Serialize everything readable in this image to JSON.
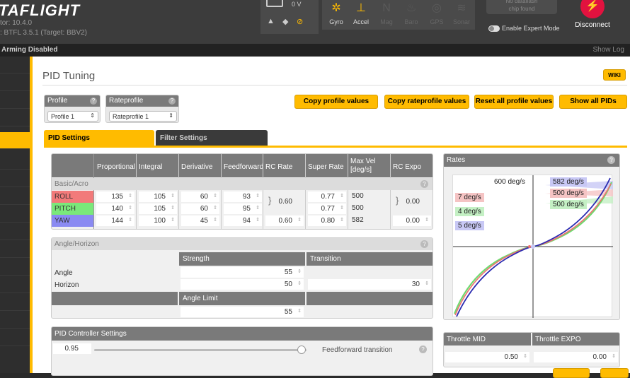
{
  "header": {
    "logo_text": "TAFLIGHT",
    "configurator_version": "tor: 10.4.0",
    "firmware_version": ": BTFL 3.5.1 (Target: BBV2)",
    "battery_voltage": "0 V",
    "sensors": [
      {
        "label": "Gyro",
        "icon": "gyro-icon",
        "active": true
      },
      {
        "label": "Accel",
        "icon": "accel-icon",
        "active": true
      },
      {
        "label": "Mag",
        "icon": "mag-icon",
        "active": false
      },
      {
        "label": "Baro",
        "icon": "baro-icon",
        "active": false
      },
      {
        "label": "GPS",
        "icon": "gps-icon",
        "active": false
      },
      {
        "label": "Sonar",
        "icon": "sonar-icon",
        "active": false
      }
    ],
    "dataflash": "No dataflash\nchip found",
    "expert_mode_label": "Enable Expert Mode",
    "disconnect_label": "Disconnect"
  },
  "status": {
    "arming": "Arming Disabled",
    "show_log": "Show Log"
  },
  "page": {
    "title": "PID Tuning",
    "wiki": "WIKI"
  },
  "profile": {
    "label": "Profile",
    "value": "Profile 1"
  },
  "rateprofile": {
    "label": "Rateprofile",
    "value": "Rateprofile 1"
  },
  "buttons": {
    "copy_profile": "Copy profile values",
    "copy_rateprofile": "Copy rateprofile values",
    "reset_profile": "Reset all profile values",
    "show_all_pids": "Show all PIDs"
  },
  "tabs": {
    "pid_settings": "PID Settings",
    "filter_settings": "Filter Settings"
  },
  "pid_table": {
    "headers": {
      "proportional": "Proportional",
      "integral": "Integral",
      "derivative": "Derivative",
      "feedforward": "Feedforward",
      "rc_rate": "RC Rate",
      "super_rate": "Super Rate",
      "max_vel_1": "Max Vel",
      "max_vel_2": "[deg/s]",
      "rc_expo": "RC Expo"
    },
    "section": "Basic/Acro",
    "rows": [
      {
        "axis": "ROLL",
        "color": "#f27a7a",
        "p": "135",
        "i": "105",
        "d": "60",
        "ff": "93",
        "super_rate": "0.77",
        "max_vel": "500"
      },
      {
        "axis": "PITCH",
        "color": "#7ae87a",
        "p": "140",
        "i": "105",
        "d": "60",
        "ff": "95",
        "super_rate": "0.77",
        "max_vel": "500"
      },
      {
        "axis": "YAW",
        "color": "#8a8af2",
        "p": "144",
        "i": "100",
        "d": "45",
        "ff": "94",
        "rc_rate": "0.60",
        "super_rate": "0.80",
        "max_vel": "582",
        "rc_expo": "0.00"
      }
    ],
    "rollpitch_rc_rate": "0.60",
    "rollpitch_rc_expo": "0.00"
  },
  "angle_horizon": {
    "title": "Angle/Horizon",
    "strength_label": "Strength",
    "transition_label": "Transition",
    "angle_label": "Angle",
    "horizon_label": "Horizon",
    "angle_strength": "55",
    "horizon_strength": "50",
    "horizon_transition": "30",
    "angle_limit_label": "Angle Limit",
    "angle_limit": "55"
  },
  "controller": {
    "title": "PID Controller Settings",
    "ff_transition_value": "0.95",
    "ff_transition_label": "Feedforward transition"
  },
  "rates": {
    "title": "Rates",
    "max_label": "600 deg/s",
    "left_labels": [
      {
        "text": "7 deg/s",
        "color": "#f5c4c4"
      },
      {
        "text": "4 deg/s",
        "color": "#c4f0c4"
      },
      {
        "text": "5 deg/s",
        "color": "#c8c8f5"
      }
    ],
    "right_labels": [
      {
        "text": "582 deg/s",
        "color": "#c8c8f5"
      },
      {
        "text": "500 deg/s",
        "color": "#f5c4c4"
      },
      {
        "text": "500 deg/s",
        "color": "#c4f0c4"
      }
    ]
  },
  "throttle": {
    "mid_label": "Throttle MID",
    "expo_label": "Throttle EXPO",
    "mid_value": "0.50",
    "expo_value": "0.00"
  }
}
